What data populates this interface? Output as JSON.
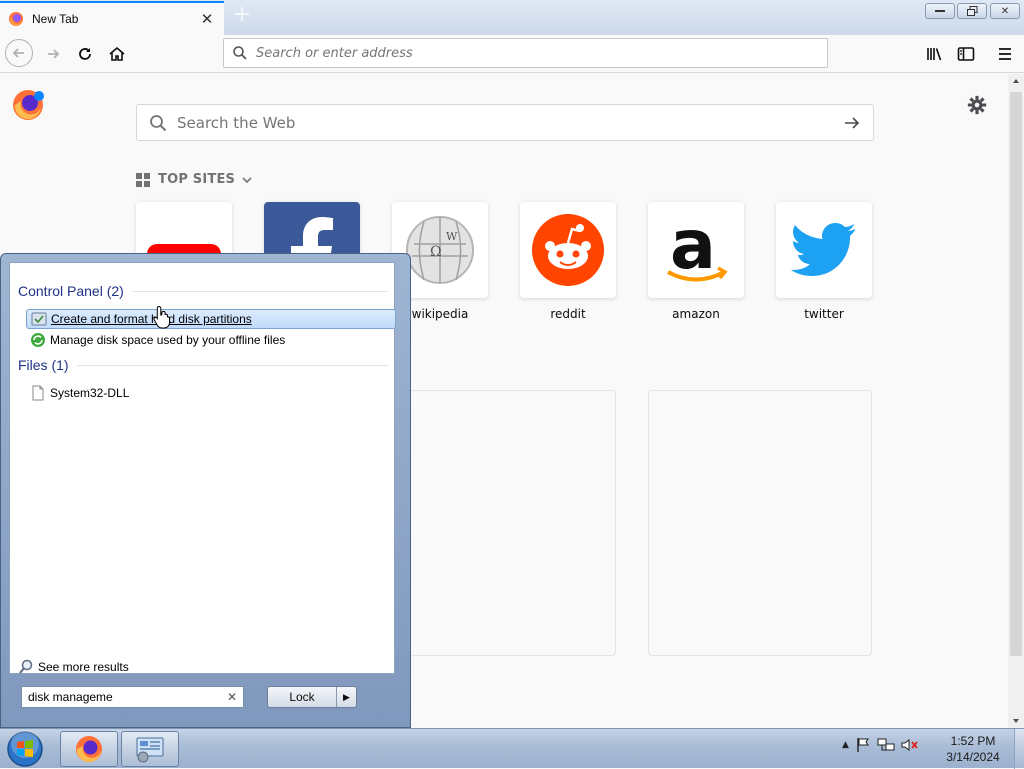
{
  "browser": {
    "tab": {
      "title": "New Tab",
      "favicon": "firefox-icon"
    },
    "newtab_symbol": "+",
    "urlbar": {
      "placeholder": "Search or enter address"
    },
    "window_controls": [
      "minimize",
      "restore",
      "close"
    ]
  },
  "newtab": {
    "search_placeholder": "Search the Web",
    "topsites_label": "TOP SITES",
    "sites": [
      {
        "label": "",
        "icon": "youtube-logo"
      },
      {
        "label": "",
        "icon": "facebook-logo"
      },
      {
        "label": "wikipedia",
        "icon": "wikipedia-logo"
      },
      {
        "label": "reddit",
        "icon": "reddit-logo"
      },
      {
        "label": "amazon",
        "icon": "amazon-logo"
      },
      {
        "label": "twitter",
        "icon": "twitter-logo"
      }
    ]
  },
  "startmenu": {
    "groups": {
      "control_panel": "Control Panel (2)",
      "files": "Files (1)"
    },
    "items": [
      {
        "label": "Create and format hard disk partitions",
        "icon": "disk-management-icon",
        "selected": true
      },
      {
        "label": "Manage disk space used by your offline files",
        "icon": "sync-center-icon",
        "selected": false
      },
      {
        "label": "System32-DLL",
        "icon": "file-icon",
        "selected": false
      }
    ],
    "see_more": "See more results",
    "search_value": "disk manageme",
    "lock_button": "Lock"
  },
  "taskbar": {
    "apps": [
      "firefox-icon",
      "control-panel-icon"
    ],
    "clock": {
      "time": "1:52 PM",
      "date": "3/14/2024"
    }
  },
  "colors": {
    "accent": "#0a84ff",
    "reddit": "#ff4500",
    "twitter": "#1da1f2",
    "facebook": "#3b5998",
    "youtube": "#ff0000",
    "amazon_arrow": "#ff9900"
  }
}
